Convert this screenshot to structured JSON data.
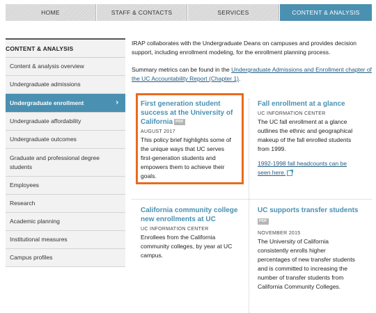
{
  "nav": {
    "tabs": [
      {
        "label": "HOME"
      },
      {
        "label": "STAFF & CONTACTS"
      },
      {
        "label": "SERVICES"
      },
      {
        "label": "CONTENT & ANALYSIS",
        "active": true
      }
    ]
  },
  "sidebar": {
    "heading": "CONTENT & ANALYSIS",
    "items": [
      {
        "label": "Content & analysis overview"
      },
      {
        "label": "Undergraduate admissions"
      },
      {
        "label": "Undergraduate enrollment",
        "active": true,
        "chevron": "›"
      },
      {
        "label": "Undergraduate affordability"
      },
      {
        "label": "Undergraduate outcomes"
      },
      {
        "label": "Graduate and professional degree students"
      },
      {
        "label": "Employees"
      },
      {
        "label": "Research"
      },
      {
        "label": "Academic planning"
      },
      {
        "label": "Institutional measures"
      },
      {
        "label": "Campus profiles"
      }
    ]
  },
  "main": {
    "intro": "IRAP collaborates with the Undergraduate Deans on campuses and provides decision support, including enrollment modeling, for the enrollment planning process.",
    "summary_prefix": "Summary metrics can be found in the ",
    "summary_link": "Undergraduate Admissions and Enrollment chapter of the UC Accountability Report (Chapter 1)",
    "summary_suffix": "."
  },
  "cards": [
    {
      "title": "First generation student success at the University of California",
      "badge": "PDF",
      "meta": "AUGUST 2017",
      "description": "This policy brief highlights some of the unique ways that UC serves first-generation students and empowers them to achieve their goals."
    },
    {
      "title": "Fall enrollment at a glance",
      "meta": "UC INFORMATION CENTER",
      "description": "The UC fall enrollment at a glance outlines the ethnic and geographical makeup of the fall enrolled students from 1999.",
      "link": "1992-1998 fall headcounts can be seen here."
    },
    {
      "title": "California community college new enrollments at UC",
      "meta": "UC INFORMATION CENTER",
      "description": "Enrollees from the California community colleges, by year at UC campus."
    },
    {
      "title": "UC supports transfer students",
      "badge": "PDF",
      "meta": "NOVEMBER 2015",
      "description": "The University of California consistently enrolls higher percentages of new transfer students and is committed to increasing the number of transfer students from California Community Colleges."
    }
  ],
  "colors": {
    "accent": "#4a90b1",
    "highlight": "#ea6a1c",
    "link": "#235a80"
  }
}
